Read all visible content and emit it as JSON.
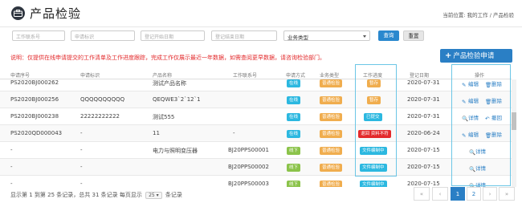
{
  "header": {
    "title": "产品检验",
    "breadcrumb_prefix": "当前位置:",
    "breadcrumb_items": [
      "我的工作",
      "/",
      "产品检验"
    ]
  },
  "filters": {
    "apply_no_placeholder": "工作联系号",
    "apply_id_placeholder": "申请标识",
    "start_date_placeholder": "登记开始日期",
    "end_date_placeholder": "登记结束日期",
    "business_type_value": "业务类型",
    "query_label": "查询",
    "reset_label": "重置"
  },
  "note": "说明：仅提供在线申请提交的工作清单及工作进度跟踪，完成工作仅展示最近一年数据，如需查阅更早数据，请咨询检验部门。",
  "apply_button_label": "产品检验申请",
  "table": {
    "headers": [
      "申请序号",
      "申请标识",
      "产品名称",
      "工作联系号",
      "申请方式",
      "业务类型",
      "工作进度",
      "登记日期",
      "操作"
    ],
    "rows": [
      {
        "seq": "PS2020BJ000262",
        "mark": "",
        "product": "测试产品名称",
        "work_no": "",
        "method": "在线",
        "btype": "普通检验",
        "progress": "暂存",
        "date": "2020-07-31",
        "actions": [
          "编辑",
          "删除"
        ]
      },
      {
        "seq": "PS2020BJ000256",
        "mark": "QQQQQQQQQQ",
        "product": "QEQWE3`2`12`1",
        "work_no": "",
        "method": "在线",
        "btype": "普通检验",
        "progress": "暂存",
        "date": "2020-07-31",
        "actions": [
          "编辑",
          "删除"
        ]
      },
      {
        "seq": "PS2020BJ000238",
        "mark": "22222222222",
        "product": "测试555",
        "work_no": "",
        "method": "在线",
        "btype": "普通检验",
        "progress": "已提交",
        "date": "2020-07-31",
        "actions": [
          "详情",
          "撤回"
        ]
      },
      {
        "seq": "PS2020QD000043",
        "mark": "-",
        "product": "11",
        "work_no": "-",
        "method": "在线",
        "btype": "普通检验",
        "progress": "退回 资料不符",
        "date": "2020-06-24",
        "actions": [
          "编辑",
          "删除"
        ]
      },
      {
        "seq": "-",
        "mark": "-",
        "product": "电力与照明变压器",
        "work_no": "BJ20PPS00001",
        "method": "线下",
        "btype": "普通检验",
        "progress": "文件编制中",
        "date": "2020-07-15",
        "actions": [
          "详情"
        ]
      },
      {
        "seq": "-",
        "mark": "-",
        "product": "",
        "work_no": "BJ20PPS00002",
        "method": "线下",
        "btype": "普通检验",
        "progress": "文件编制中",
        "date": "2020-07-15",
        "actions": [
          "详情"
        ]
      },
      {
        "seq": "-",
        "mark": "-",
        "product": "",
        "work_no": "BJ20PPS00003",
        "method": "线下",
        "btype": "普通检验",
        "progress": "文件编制中",
        "date": "2020-07-15",
        "actions": [
          "详情"
        ]
      }
    ]
  },
  "footer": {
    "summary": "显示第 1 到第 25 条记录，总共 31 条记录 每页显示",
    "page_size": "25",
    "suffix": "条记录"
  },
  "pagination": [
    "«",
    "‹",
    "1",
    "2",
    "›",
    "»"
  ],
  "colors": {
    "primary": "#2a7fc5",
    "online": "#2cb8e0",
    "offline": "#8bc34a",
    "btype": "#f0ad4e",
    "draft": "#f0ad4e",
    "submitted": "#2cb8e0",
    "returned": "#e3292b",
    "preparing": "#2cb8e0",
    "note": "#e3292b",
    "highlight_border": "#6cc6e6"
  }
}
